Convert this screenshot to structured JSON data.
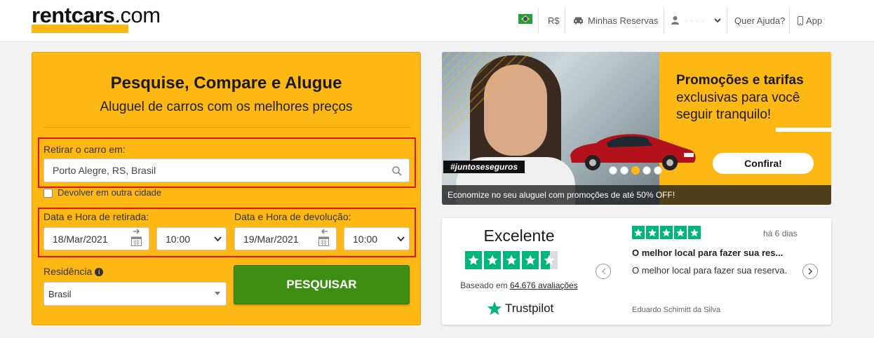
{
  "header": {
    "logo_brand": "rentcars",
    "logo_suffix": ".com",
    "currency": "R$",
    "reservations": "Minhas Reservas",
    "user_name": "· · · ·",
    "help": "Quer Ajuda?",
    "app": "App"
  },
  "search": {
    "title": "Pesquise, Compare e Alugue",
    "subtitle": "Aluguel de carros com os melhores preços",
    "pickup_label": "Retirar o carro em:",
    "pickup_value": "Porto Alegre, RS, Brasil",
    "return_other_city": "Devolver em outra cidade",
    "pickup_datetime_label": "Data e Hora de retirada:",
    "pickup_date": "18/Mar/2021",
    "pickup_time": "10:00",
    "return_datetime_label": "Data e Hora de devolução:",
    "return_date": "19/Mar/2021",
    "return_time": "10:00",
    "residence_label": "Residência",
    "residence_value": "Brasil",
    "submit": "PESQUISAR"
  },
  "promo": {
    "title": "Promoções e tarifas",
    "text": "exclusivas para você seguir tranquilo!",
    "hashtag": "#juntoseseguros",
    "cta": "Confira!",
    "footer": "Economize no seu aluguel com promoções de até 50% OFF!",
    "slides": 5,
    "active_slide": 3
  },
  "trustpilot": {
    "rating_word": "Excelente",
    "based_prefix": "Baseado em",
    "reviews_count": "64.676 avaliações",
    "brand": "Trustpilot",
    "review_time": "há 6 dias",
    "review_title": "O melhor local para fazer sua res...",
    "review_body": "O melhor local para fazer sua reserva.",
    "review_author": "Eduardo Schimitt da Silva",
    "star_rating": 4.5
  },
  "colors": {
    "brand_yellow": "#fdb813",
    "search_green": "#3e8e13",
    "trustpilot_green": "#00b67a",
    "highlight_red": "#e8131a"
  }
}
